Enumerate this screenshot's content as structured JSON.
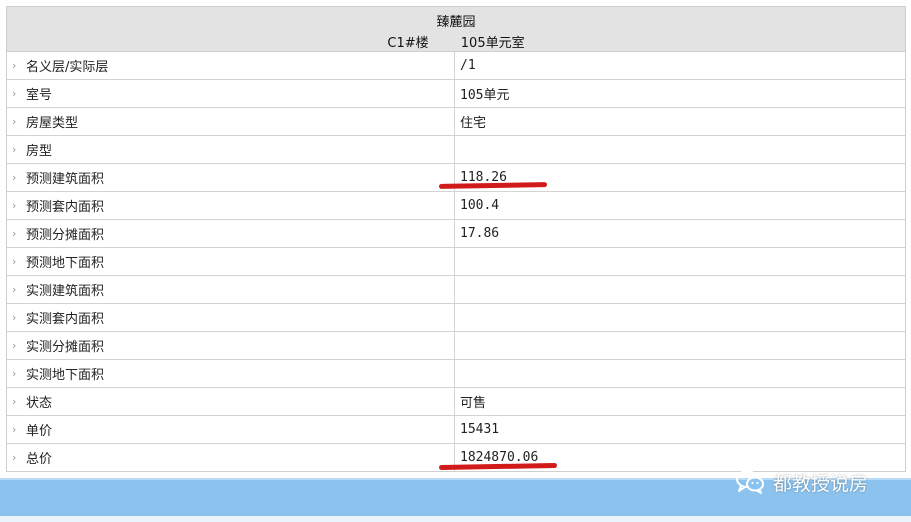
{
  "header": {
    "title": "臻麓园",
    "building": "C1#楼",
    "unit": "105单元室"
  },
  "rows": [
    {
      "label": "名义层/实际层",
      "value": "/1"
    },
    {
      "label": "室号",
      "value": "105单元"
    },
    {
      "label": "房屋类型",
      "value": "住宅"
    },
    {
      "label": "房型",
      "value": ""
    },
    {
      "label": "预测建筑面积",
      "value": "118.26"
    },
    {
      "label": "预测套内面积",
      "value": "100.4"
    },
    {
      "label": "预测分摊面积",
      "value": "17.86"
    },
    {
      "label": "预测地下面积",
      "value": ""
    },
    {
      "label": "实测建筑面积",
      "value": ""
    },
    {
      "label": "实测套内面积",
      "value": ""
    },
    {
      "label": "实测分摊面积",
      "value": ""
    },
    {
      "label": "实测地下面积",
      "value": ""
    },
    {
      "label": "状态",
      "value": "可售"
    },
    {
      "label": "单价",
      "value": "15431"
    },
    {
      "label": "总价",
      "value": "1824870.06"
    }
  ],
  "watermark": {
    "text": "都教授说房",
    "icon": "wechat-icon"
  },
  "colors": {
    "header_bg": "#e3e3e3",
    "underline": "#d11a1a",
    "bottom_bar": "#8cc3ee"
  }
}
